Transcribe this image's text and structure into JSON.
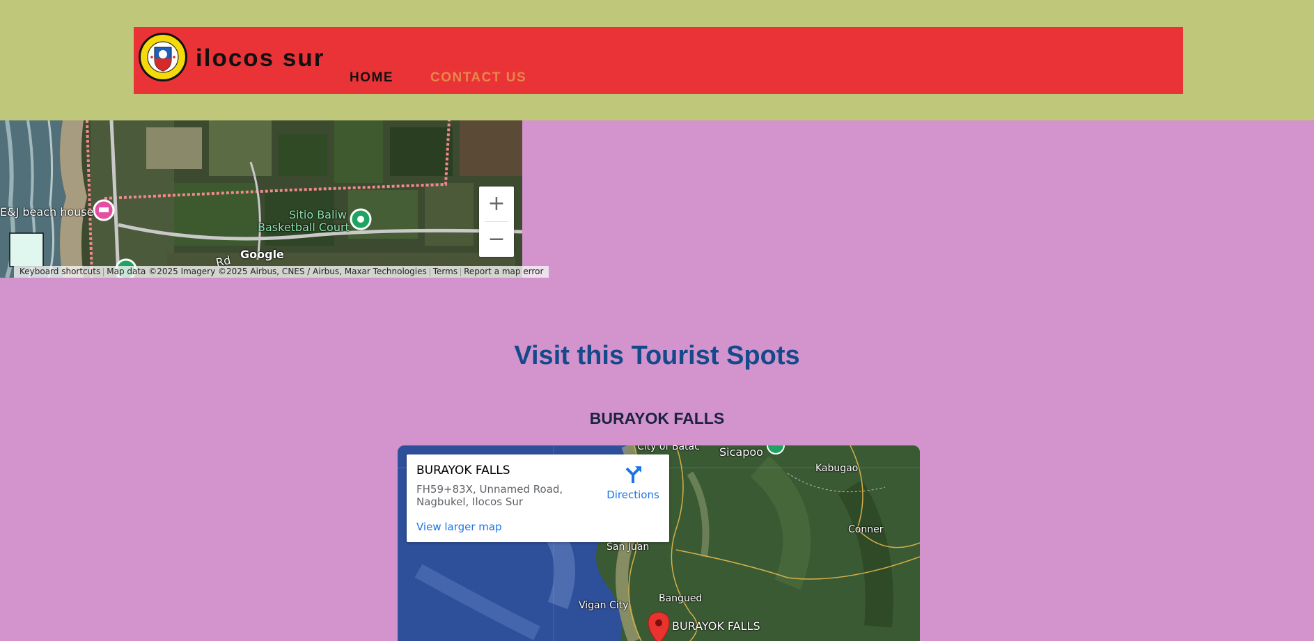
{
  "header": {
    "site_title": "ilocos sur",
    "logo_text": "PROVINCE OF ILOCOS SUR · OFFICIAL SEAL",
    "nav": [
      {
        "label": "HOME"
      },
      {
        "label": "CONTACT US"
      }
    ]
  },
  "map_top": {
    "labels": {
      "beach_house": "E&J beach house",
      "court_line1": "Sitio Baliw",
      "court_line2": "Basketball Court",
      "road": "Rd",
      "google": "Google"
    },
    "zoom_in": "+",
    "zoom_out": "−",
    "attribution": {
      "shortcuts": "Keyboard shortcuts",
      "data": "Map data ©2025 Imagery ©2025 Airbus, CNES / Airbus, Maxar Technologies",
      "terms": "Terms",
      "report": "Report a map error"
    }
  },
  "main": {
    "section_title": "Visit this Tourist Spots",
    "spots": [
      {
        "title": "BURAYOK FALLS",
        "card": {
          "name": "BURAYOK FALLS",
          "address": "FH59+83X, Unnamed Road, Nagbukel, Ilocos Sur",
          "directions": "Directions",
          "larger_map": "View larger map"
        },
        "map_labels": {
          "batac": "City of Batac",
          "sicapoo": "Sicapoo",
          "kabugao": "Kabugao",
          "conner": "Conner",
          "san_juan": "San Juan",
          "vigan": "Vigan City",
          "bangued": "Bangued",
          "marker": "BURAYOK FALLS"
        }
      }
    ]
  },
  "colors": {
    "page_bg": "#d393cc",
    "top_band": "#bfc87a",
    "header_red": "#ea3336",
    "nav_active": "#111111",
    "nav_contact": "#e8874a",
    "heading_blue": "#144a8a"
  }
}
